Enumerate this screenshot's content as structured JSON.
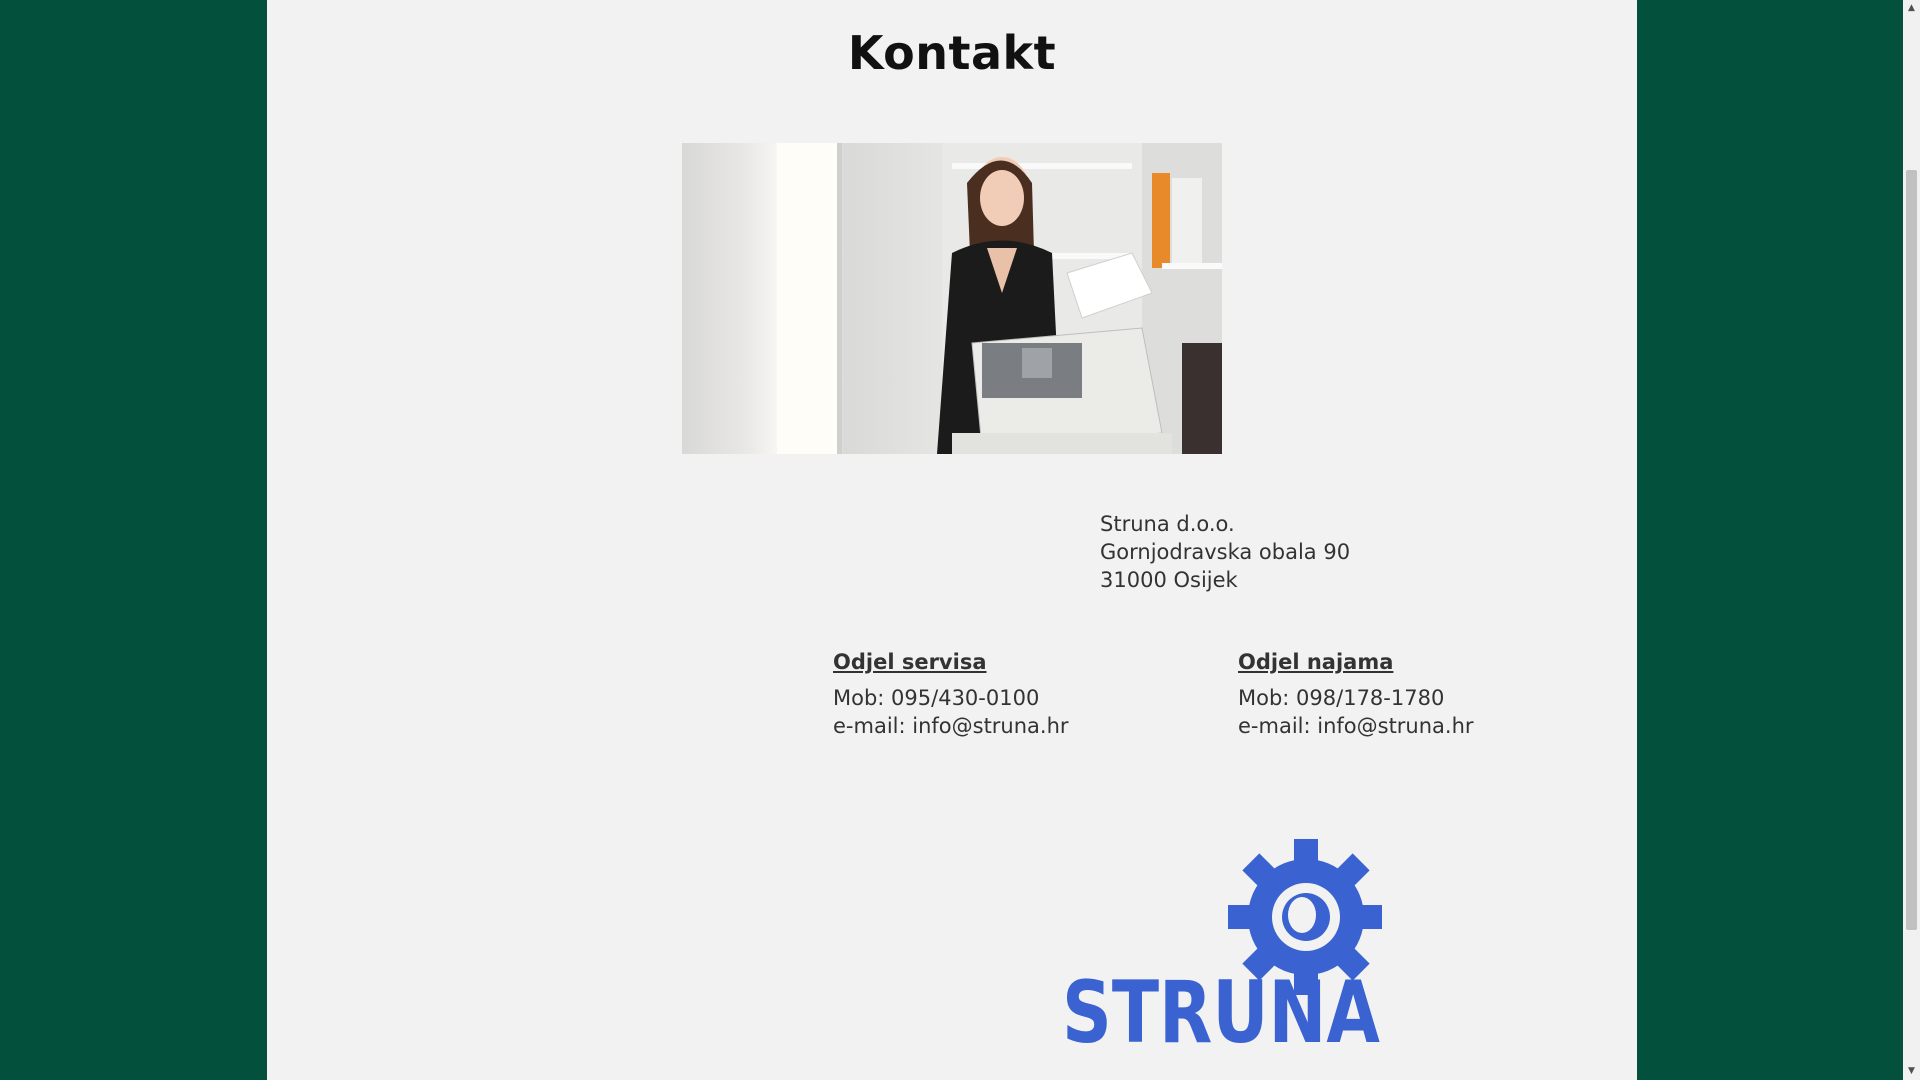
{
  "page": {
    "title": "Kontakt"
  },
  "address": {
    "company": "Struna d.o.o.",
    "street": "Gornjodravska obala 90",
    "city": "31000 Osijek"
  },
  "departments": [
    {
      "title": "Odjel servisa",
      "phone": "Mob: 095/430-0100",
      "email": "e-mail: info@struna.hr"
    },
    {
      "title": "Odjel najama",
      "phone": "Mob: 098/178-1780",
      "email": "e-mail: info@struna.hr"
    }
  ],
  "logo": {
    "text": "STRUNA",
    "color": "#3a63d1"
  },
  "colors": {
    "background": "#03513c",
    "content": "#f2f2f2"
  }
}
